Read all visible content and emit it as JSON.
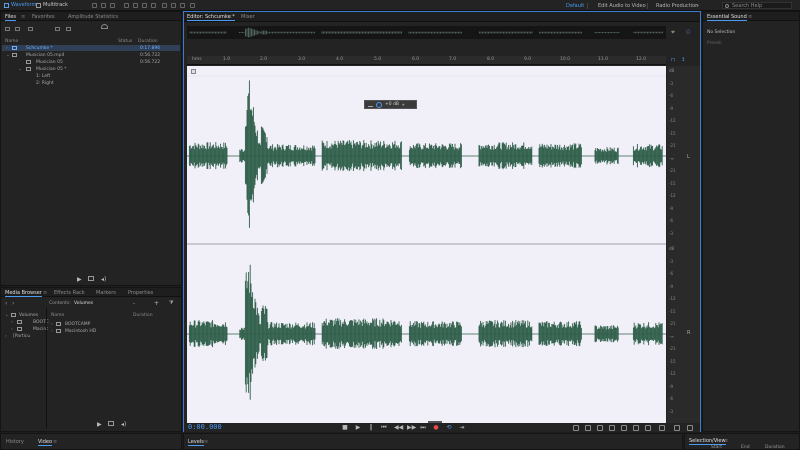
{
  "topbar": {
    "waveform_label": "Waveform",
    "multitrack_label": "Multitrack",
    "workspaces": [
      "Default",
      "Edit Audio to Video",
      "Radio Production"
    ],
    "search_placeholder": "Search Help"
  },
  "files_panel": {
    "tabs": [
      "Files",
      "Favorites",
      "Amplitude Statistics"
    ],
    "columns": {
      "name": "Name",
      "status": "Status",
      "duration": "Duration"
    },
    "rows": [
      {
        "name": "Schcumke *",
        "duration": "0:17.896",
        "selected": true,
        "indent": 1
      },
      {
        "name": "Musician 05.mp4",
        "duration": "0:56.722",
        "selected": false,
        "indent": 1
      },
      {
        "name": "Musician 05",
        "duration": "0:56.722",
        "selected": false,
        "indent": 2
      },
      {
        "name": "Musician 05 *",
        "duration": "",
        "selected": false,
        "indent": 2
      },
      {
        "name": "1: Left",
        "duration": "",
        "selected": false,
        "indent": 3
      },
      {
        "name": "2: Right",
        "duration": "",
        "selected": false,
        "indent": 3
      }
    ]
  },
  "media_panel": {
    "tabs": [
      "Media Browser",
      "Effects Rack",
      "Markers",
      "Properties"
    ],
    "contents_label": "Contents:",
    "contents_value": "Volumes",
    "left_items": [
      "Volumes",
      "BOOTC",
      "Macint",
      "[Particu"
    ],
    "columns": {
      "name": "Name",
      "duration": "Duration"
    },
    "rows": [
      "BOOTCAMP",
      "Macintosh HD"
    ]
  },
  "editor": {
    "tabs": [
      "Editor: Schcumke *",
      "Mixer"
    ],
    "ruler_labels": [
      "hms",
      "1.0",
      "2.0",
      "3.0",
      "4.0",
      "5.0",
      "6.0",
      "7.0",
      "8.0",
      "9.0",
      "10.0",
      "11.0",
      "12.0"
    ],
    "hud_value": "+0 dB",
    "timecode": "0:00.000",
    "db_labels_top": [
      "dB",
      "-3",
      "-6",
      "-9",
      "-12",
      "-15",
      "-21",
      "-∞",
      "-21",
      "-15",
      "-12",
      "-9",
      "-6",
      "-3"
    ],
    "db_labels_bottom": [
      "dB",
      "-3",
      "-6",
      "-9",
      "-12",
      "-15",
      "-21",
      "-∞",
      "-21",
      "-15",
      "-12",
      "-9",
      "-6",
      "-3"
    ],
    "channel_top": "L",
    "channel_bottom": "R"
  },
  "right_panel": {
    "tab": "Essential Sound",
    "no_selection": "No Selection",
    "preset_label": "Preset:"
  },
  "bottom": {
    "history_tab": "History",
    "video_tab": "Video",
    "levels_tab": "Levels",
    "selection_tab": "Selection/View",
    "selection_cols": [
      "Start",
      "End",
      "Duration"
    ]
  },
  "colors": {
    "accent": "#4b9bf0",
    "waveform": "#2f5e4a",
    "wave_bg": "#f1f0f8",
    "record": "#e84a4a"
  }
}
